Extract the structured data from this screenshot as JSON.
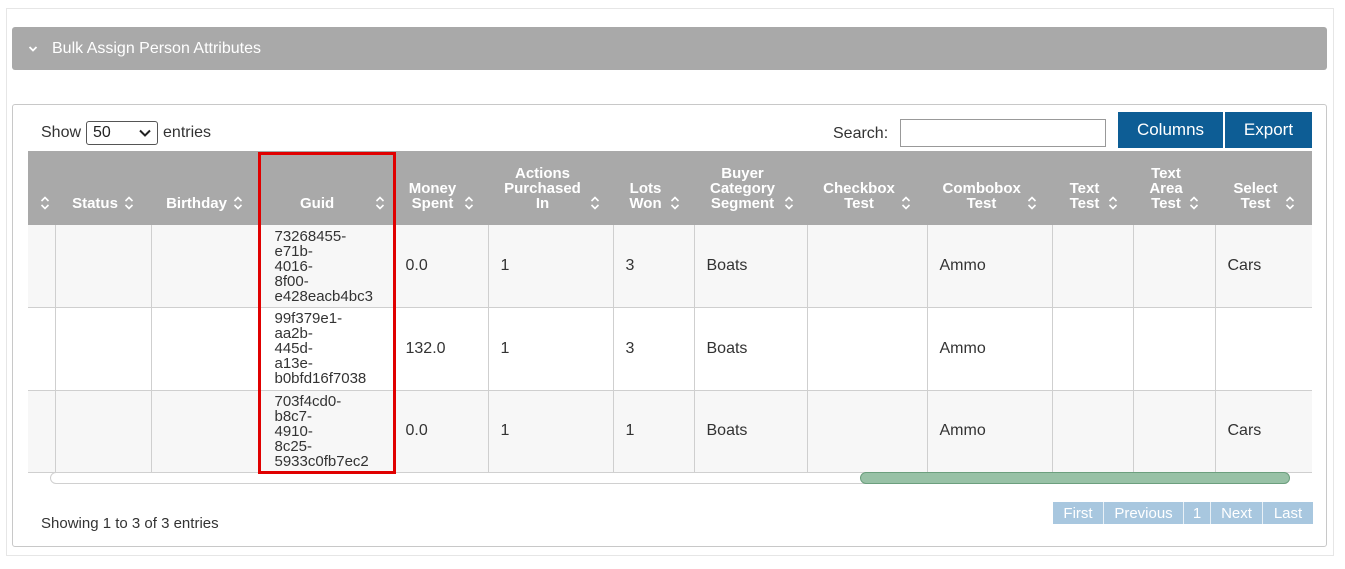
{
  "accordion": {
    "title": "Bulk Assign Person Attributes"
  },
  "controls": {
    "show_label": "Show",
    "page_size": "50",
    "entries_label": "entries",
    "search_label": "Search:",
    "search_value": "",
    "columns_button": "Columns",
    "export_button": "Export"
  },
  "table": {
    "columns": [
      "",
      "Status",
      "Birthday",
      "Guid",
      "Money Spent",
      "Actions Purchased In",
      "Lots Won",
      "Buyer Category Segment",
      "Checkbox Test",
      "Combobox Test",
      "Text Test",
      "Text Area Test",
      "Select Test"
    ],
    "rows": [
      [
        "",
        "",
        "",
        "73268455-e71b-4016-8f00-e428eacb4bc3",
        "0.0",
        "1",
        "3",
        "Boats",
        "",
        "Ammo",
        "",
        "",
        "Cars"
      ],
      [
        "",
        "",
        "",
        "99f379e1-aa2b-445d-a13e-b0bfd16f7038",
        "132.0",
        "1",
        "3",
        "Boats",
        "",
        "Ammo",
        "",
        "",
        ""
      ],
      [
        "",
        "",
        "",
        "703f4cd0-b8c7-4910-8c25-5933c0fb7ec2",
        "0.0",
        "1",
        "1",
        "Boats",
        "",
        "Ammo",
        "",
        "",
        "Cars"
      ]
    ]
  },
  "footer": {
    "info": "Showing 1 to 3 of 3 entries"
  },
  "pagination": {
    "first": "First",
    "previous": "Previous",
    "page": "1",
    "next": "Next",
    "last": "Last"
  },
  "colors": {
    "header_gray": "#a9a9a9",
    "button_blue": "#0d5d95",
    "highlight_red": "#e00000",
    "pager_blue": "#a8c7df"
  }
}
